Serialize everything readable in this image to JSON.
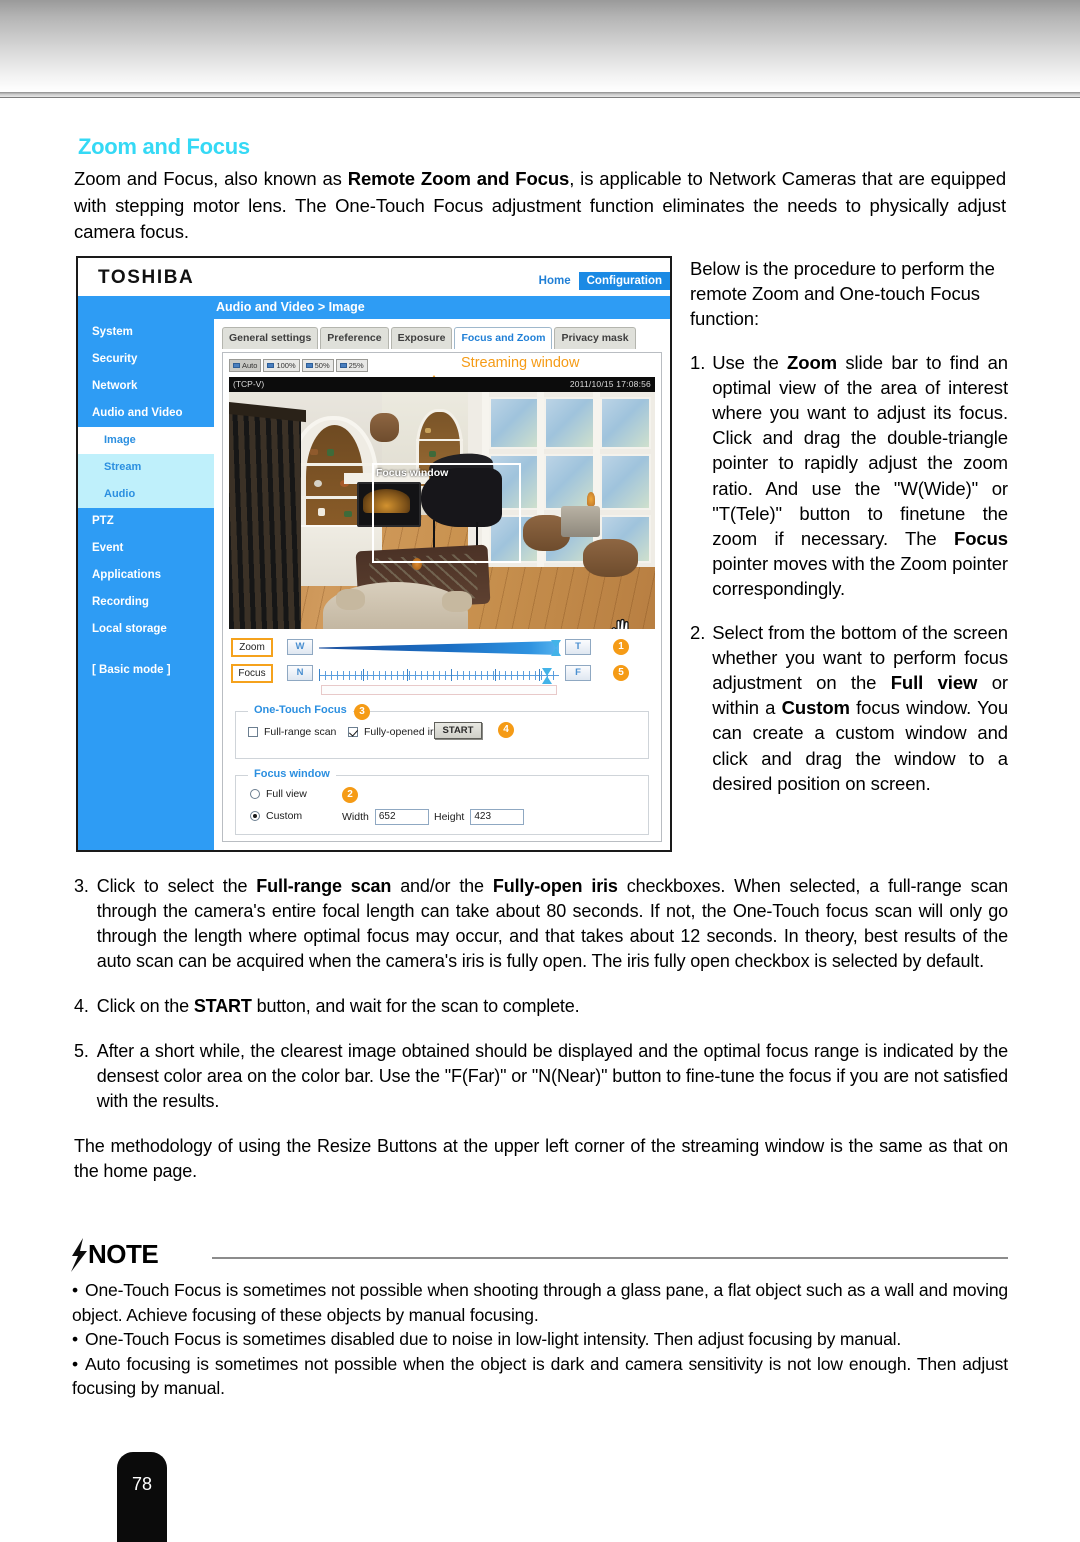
{
  "section": {
    "title": "Zoom and Focus",
    "intro_a": "Zoom and Focus, also known as ",
    "intro_b": "Remote Zoom and Focus",
    "intro_c": ", is applicable to Network Cameras that are equipped with stepping motor lens. The One-Touch Focus adjustment function eliminates the needs to physically adjust camera focus."
  },
  "screenshot": {
    "brand": "TOSHIBA",
    "topnav": {
      "home": "Home",
      "configuration": "Configuration"
    },
    "breadcrumb": "Audio and Video > Image",
    "sidebar": [
      {
        "label": "System",
        "state": "normal"
      },
      {
        "label": "Security",
        "state": "normal"
      },
      {
        "label": "Network",
        "state": "normal"
      },
      {
        "label": "Audio and Video",
        "state": "normal"
      },
      {
        "label": "Image",
        "state": "selected-white"
      },
      {
        "label": "Stream",
        "state": "selected-pale"
      },
      {
        "label": "Audio",
        "state": "selected-pale"
      },
      {
        "label": "PTZ",
        "state": "normal"
      },
      {
        "label": "Event",
        "state": "normal"
      },
      {
        "label": "Applications",
        "state": "normal"
      },
      {
        "label": "Recording",
        "state": "normal"
      },
      {
        "label": "Local storage",
        "state": "normal"
      },
      {
        "label": "[ Basic mode ]",
        "state": "normal"
      }
    ],
    "tabs": [
      {
        "label": "General settings",
        "active": false
      },
      {
        "label": "Preference",
        "active": false
      },
      {
        "label": "Exposure",
        "active": false
      },
      {
        "label": "Focus and Zoom",
        "active": true
      },
      {
        "label": "Privacy mask",
        "active": false
      }
    ],
    "resize_buttons": [
      {
        "label": "Auto",
        "active": true
      },
      {
        "label": "100%",
        "active": false
      },
      {
        "label": "50%",
        "active": false
      },
      {
        "label": "25%",
        "active": false
      }
    ],
    "annotation_streaming_window": "Streaming window",
    "video": {
      "protocol": "(TCP-V)",
      "timestamp": "2011/10/15  17:08:56",
      "focus_window_label": "Focus window"
    },
    "zoom_row": {
      "label": "Zoom",
      "wide_button": "W",
      "tele_button": "T",
      "badge": "1"
    },
    "focus_row": {
      "label": "Focus",
      "near_button": "N",
      "far_button": "F",
      "badge": "5"
    },
    "one_touch_focus": {
      "legend": "One-Touch Focus",
      "badge": "3",
      "full_range_scan": "Full-range scan",
      "full_range_scan_checked": false,
      "fully_opened_iris": "Fully-opened iris",
      "fully_opened_iris_checked": true,
      "start_button": "START",
      "start_badge": "4"
    },
    "focus_window_box": {
      "legend": "Focus window",
      "badge": "2",
      "full_view": "Full view",
      "full_view_selected": false,
      "custom": "Custom",
      "custom_selected": true,
      "width_label": "Width",
      "width_value": "652",
      "height_label": "Height",
      "height_value": "423"
    }
  },
  "right_column": {
    "lead": "Below is the procedure to perform the remote Zoom and One-touch Focus function:",
    "step1_num": "1.",
    "step1_a": "Use the ",
    "step1_zoom": "Zoom",
    "step1_b": " slide bar to find an optimal view of the area of interest where you want to adjust its focus. Click and drag the double-triangle pointer to rapidly adjust the zoom ratio. And use the \"W(Wide)\" or \"T(Tele)\" button to finetune the zoom if necessary. The ",
    "step1_focus": "Focus",
    "step1_c": " pointer moves with the Zoom pointer correspondingly.",
    "step2_num": "2.",
    "step2_a": "Select from the bottom of the screen whether you want to perform focus adjustment on the ",
    "step2_fullview": "Full view",
    "step2_b": " or within a ",
    "step2_custom": "Custom",
    "step2_c": " focus window. You can create a custom window and click and drag the window to a desired position on screen."
  },
  "lower": {
    "step3_num": "3.",
    "step3_a": "Click to select the ",
    "step3_b1": "Full-range scan",
    "step3_b": " and/or the ",
    "step3_b2": "Fully-open iris",
    "step3_c": " checkboxes. When selected, a full-range scan through the camera's entire focal length can take about 80 seconds. If not, the One-Touch focus scan will only go through the length where optimal focus may occur, and that takes about 12 seconds. In theory, best results of the auto scan can be acquired when the camera's iris is fully open. The iris fully open checkbox is selected by default.",
    "step4_num": "4.",
    "step4_a": "Click on the ",
    "step4_b": "START",
    "step4_c": " button, and wait for the scan to complete.",
    "step5_num": "5.",
    "step5_text": "After a short while, the clearest image obtained should be displayed and the optimal focus range is indicated by the densest color area on the color bar. Use the \"F(Far)\" or \"N(Near)\" button to fine-tune the focus if you are not satisfied with the results.",
    "closing": "The methodology of using the Resize Buttons at the upper left corner of the streaming window is the same as that on the home page."
  },
  "note": {
    "title": "NOTE",
    "bullets": [
      "One-Touch Focus is sometimes not possible when shooting through a glass pane, a flat object such as a wall and moving object. Achieve focusing of these objects by manual focusing.",
      "One-Touch Focus is sometimes disabled due to noise in low-light intensity. Then adjust focusing by manual.",
      "Auto focusing is sometimes not possible when the object is dark and camera sensitivity is not low enough. Then adjust focusing by manual."
    ]
  },
  "page_number": "78"
}
